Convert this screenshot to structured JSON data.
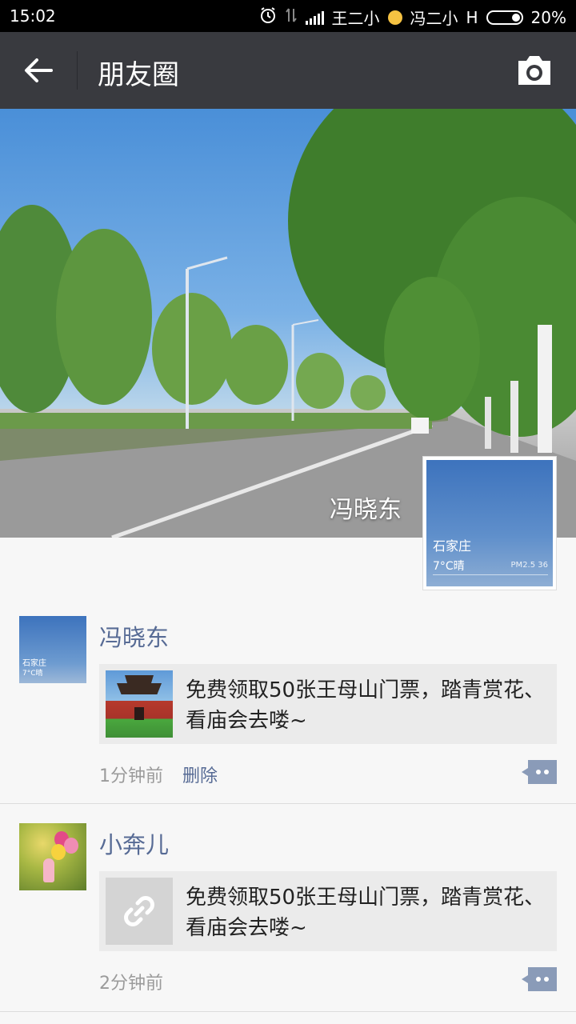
{
  "status_bar": {
    "time": "15:02",
    "carrier": "王二小",
    "carrier2": "冯二小",
    "network": "H",
    "battery": "20%"
  },
  "header": {
    "title": "朋友圈"
  },
  "cover": {
    "user_name": "冯晓东",
    "avatar_city": "石家庄",
    "avatar_temp": "7°C晴",
    "avatar_pm": "PM2.5 36"
  },
  "posts": [
    {
      "name": "冯晓东",
      "avatar_city": "石家庄",
      "avatar_temp": "7°C晴",
      "link_text": "免费领取50张王母山门票，踏青赏花、看庙会去喽~",
      "time": "1分钟前",
      "delete_label": "删除"
    },
    {
      "name": "小奔儿",
      "link_text": "免费领取50张王母山门票，踏青赏花、看庙会去喽~",
      "time": "2分钟前"
    }
  ],
  "colors": {
    "header_bg": "#393a3f",
    "name_blue": "#576b95",
    "meta_gray": "#9b9b9b"
  }
}
